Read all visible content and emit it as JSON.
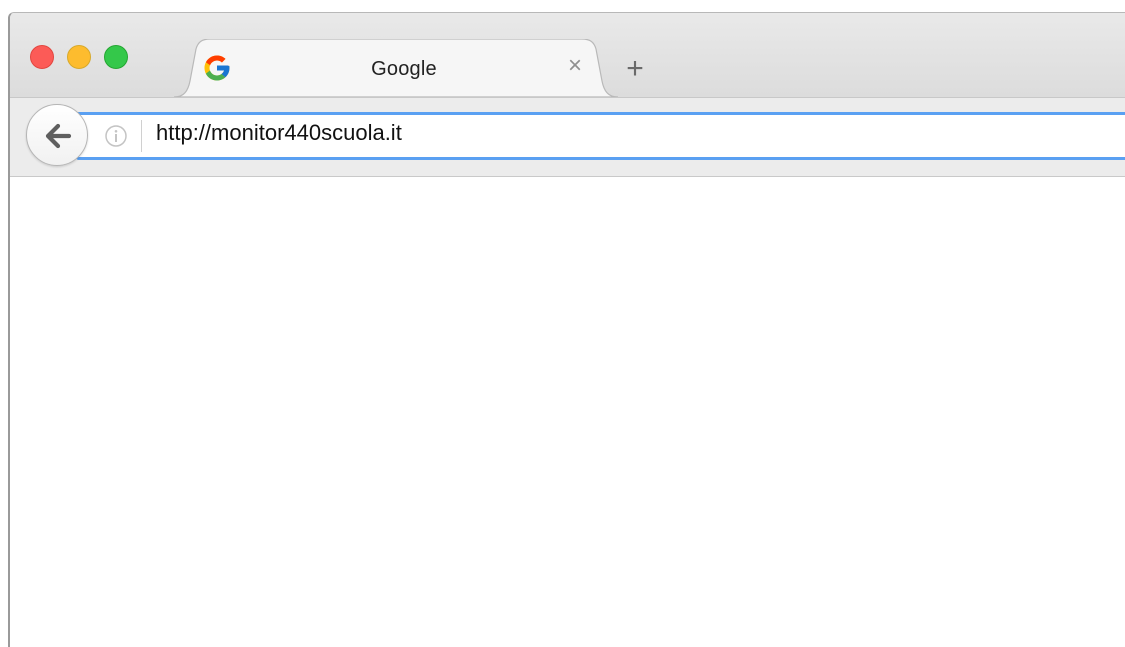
{
  "window": {
    "traffic_lights": {
      "close_color": "#fc5b57",
      "minimize_color": "#fdbc2e",
      "maximize_color": "#34c84a"
    }
  },
  "tabs": [
    {
      "title": "Google",
      "favicon": "google-g-icon",
      "close_glyph": "×",
      "active": true
    }
  ],
  "new_tab_glyph": "+",
  "toolbar": {
    "back_icon": "arrow-left-icon",
    "info_icon": "info-icon",
    "url": "http://monitor440scuola.it",
    "focus_color": "#5aa0f2"
  }
}
